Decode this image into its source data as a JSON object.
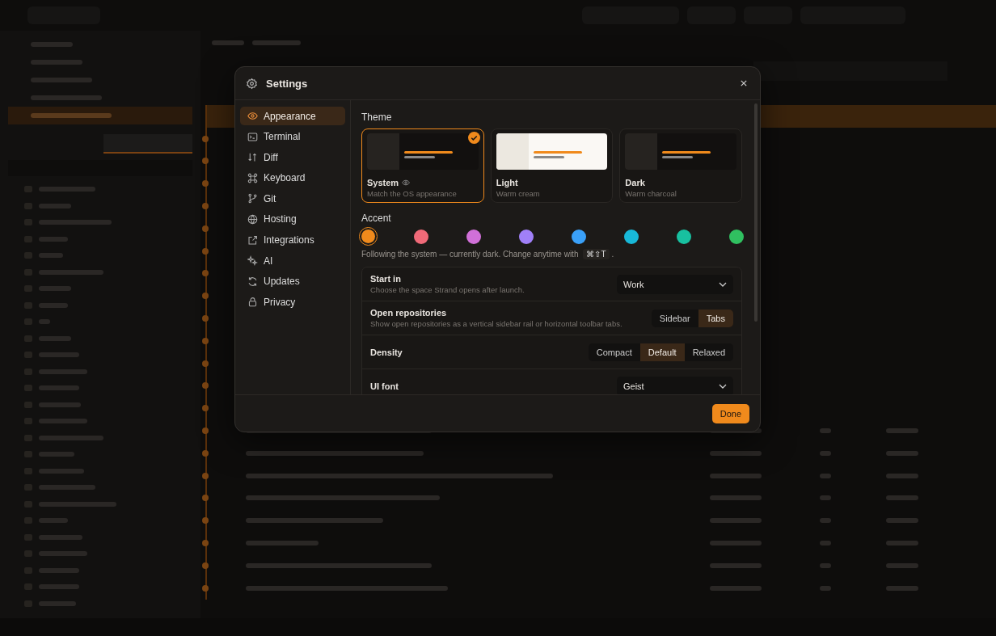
{
  "settings": {
    "title": "Settings",
    "sections": [
      {
        "label": "Appearance",
        "selected": true
      },
      {
        "label": "Terminal",
        "selected": false
      },
      {
        "label": "Diff",
        "selected": false
      },
      {
        "label": "Keyboard",
        "selected": false
      },
      {
        "label": "Git",
        "selected": false
      },
      {
        "label": "Hosting",
        "selected": false
      },
      {
        "label": "Integrations",
        "selected": false
      },
      {
        "label": "AI",
        "selected": false
      },
      {
        "label": "Updates",
        "selected": false
      },
      {
        "label": "Privacy",
        "selected": false
      }
    ],
    "theme_label": "Theme",
    "themes": [
      {
        "name": "System",
        "description": "Match the OS appearance",
        "kind": "dark",
        "follows_os": true,
        "selected": true
      },
      {
        "name": "Light",
        "description": "Warm cream",
        "kind": "light",
        "follows_os": false,
        "selected": false
      },
      {
        "name": "Dark",
        "description": "Warm charcoal",
        "kind": "dark",
        "follows_os": false,
        "selected": false
      }
    ],
    "accent_label": "Accent",
    "accents": [
      {
        "color": "#f08a1c",
        "selected": true
      },
      {
        "color": "#f06a78",
        "selected": false
      },
      {
        "color": "#d070d8",
        "selected": false
      },
      {
        "color": "#a080f8",
        "selected": false
      },
      {
        "color": "#3aa0f8",
        "selected": false
      },
      {
        "color": "#18b8d8",
        "selected": false
      },
      {
        "color": "#18c0a0",
        "selected": false
      },
      {
        "color": "#30c060",
        "selected": false
      }
    ],
    "hint": "Following the system — currently dark. Change anytime with",
    "hint_key": "⌘⇧T",
    "hint_end": ".",
    "rows": [
      {
        "kind": "select",
        "label": "Start in",
        "description": "Choose the space Strand opens after launch.",
        "value": "Work"
      },
      {
        "kind": "segmented",
        "label": "Open repositories",
        "description": "Show open repositories as a vertical sidebar rail or horizontal toolbar tabs.",
        "options": [
          {
            "label": "Sidebar",
            "selected": false
          },
          {
            "label": "Tabs",
            "selected": true
          }
        ]
      },
      {
        "kind": "segmented",
        "label": "Density",
        "options": [
          {
            "label": "Compact",
            "selected": false
          },
          {
            "label": "Default",
            "selected": true
          },
          {
            "label": "Relaxed",
            "selected": false
          }
        ]
      },
      {
        "kind": "select",
        "label": "UI font",
        "value": "Geist"
      }
    ],
    "done": "Done"
  }
}
